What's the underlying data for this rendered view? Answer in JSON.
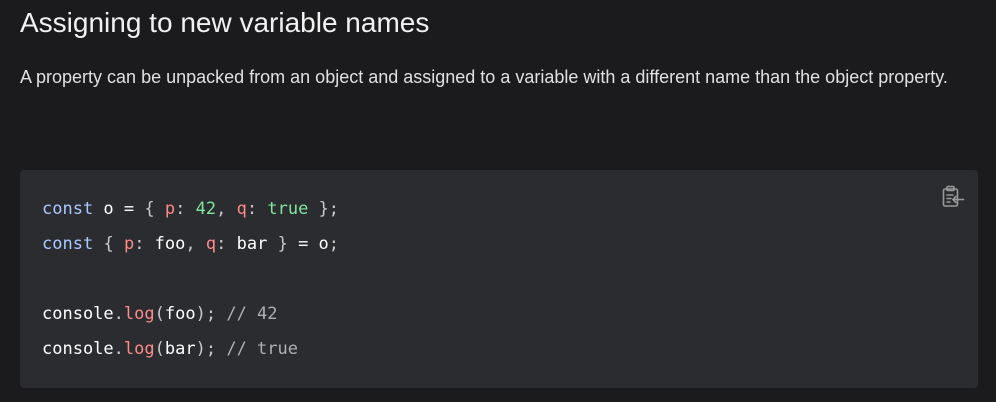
{
  "section": {
    "title": "Assigning to new variable names",
    "description": "A property can be unpacked from an object and assigned to a variable with a different name than the object property."
  },
  "code_block": {
    "language": "javascript",
    "copy_icon": "clipboard-copy-icon",
    "lines": [
      [
        {
          "t": "kw",
          "v": "const"
        },
        {
          "t": "plain",
          "v": " o = "
        },
        {
          "t": "punc",
          "v": "{"
        },
        {
          "t": "plain",
          "v": " "
        },
        {
          "t": "prop",
          "v": "p"
        },
        {
          "t": "punc",
          "v": ":"
        },
        {
          "t": "plain",
          "v": " "
        },
        {
          "t": "num",
          "v": "42"
        },
        {
          "t": "punc",
          "v": ","
        },
        {
          "t": "plain",
          "v": " "
        },
        {
          "t": "prop",
          "v": "q"
        },
        {
          "t": "punc",
          "v": ":"
        },
        {
          "t": "plain",
          "v": " "
        },
        {
          "t": "bool",
          "v": "true"
        },
        {
          "t": "plain",
          "v": " "
        },
        {
          "t": "punc",
          "v": "};"
        }
      ],
      [
        {
          "t": "kw",
          "v": "const"
        },
        {
          "t": "plain",
          "v": " "
        },
        {
          "t": "punc",
          "v": "{"
        },
        {
          "t": "plain",
          "v": " "
        },
        {
          "t": "prop",
          "v": "p"
        },
        {
          "t": "punc",
          "v": ":"
        },
        {
          "t": "plain",
          "v": " foo"
        },
        {
          "t": "punc",
          "v": ","
        },
        {
          "t": "plain",
          "v": " "
        },
        {
          "t": "prop",
          "v": "q"
        },
        {
          "t": "punc",
          "v": ":"
        },
        {
          "t": "plain",
          "v": " bar "
        },
        {
          "t": "punc",
          "v": "}"
        },
        {
          "t": "plain",
          "v": " = o"
        },
        {
          "t": "punc",
          "v": ";"
        }
      ],
      [],
      [
        {
          "t": "plain",
          "v": "console"
        },
        {
          "t": "punc",
          "v": "."
        },
        {
          "t": "fn",
          "v": "log"
        },
        {
          "t": "punc",
          "v": "("
        },
        {
          "t": "plain",
          "v": "foo"
        },
        {
          "t": "punc",
          "v": ");"
        },
        {
          "t": "plain",
          "v": " "
        },
        {
          "t": "cmt",
          "v": "// 42"
        }
      ],
      [
        {
          "t": "plain",
          "v": "console"
        },
        {
          "t": "punc",
          "v": "."
        },
        {
          "t": "fn",
          "v": "log"
        },
        {
          "t": "punc",
          "v": "("
        },
        {
          "t": "plain",
          "v": "bar"
        },
        {
          "t": "punc",
          "v": ");"
        },
        {
          "t": "plain",
          "v": " "
        },
        {
          "t": "cmt",
          "v": "// true"
        }
      ]
    ]
  },
  "colors": {
    "page_bg": "#1b1b1d",
    "code_bg": "#2b2c2f",
    "keyword": "#a8c8ff",
    "property": "#ff8a8a",
    "literal": "#7fe5a1",
    "comment": "#b0b0b0"
  }
}
